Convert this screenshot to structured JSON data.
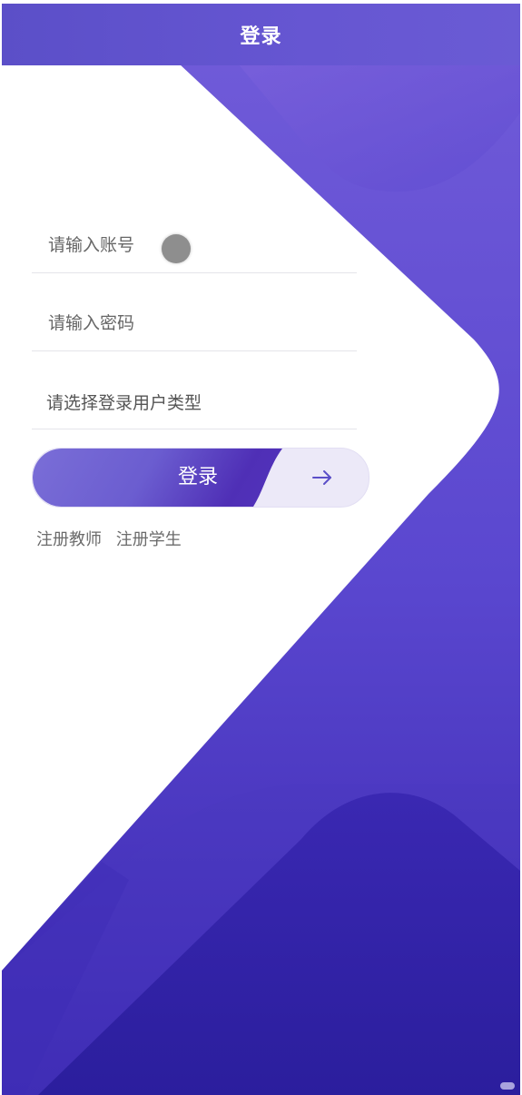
{
  "header": {
    "title": "登录"
  },
  "form": {
    "account_placeholder": "请输入账号",
    "password_placeholder": "请输入密码",
    "user_type_placeholder": "请选择登录用户类型"
  },
  "login_button": {
    "label": "登录",
    "arrow_icon": "arrow-right-icon"
  },
  "links": {
    "register_teacher": "注册教师",
    "register_student": "注册学生"
  },
  "colors": {
    "primary": "#5b4fc8",
    "deep": "#2e1f9f",
    "button_bg": "#ece9f8"
  }
}
